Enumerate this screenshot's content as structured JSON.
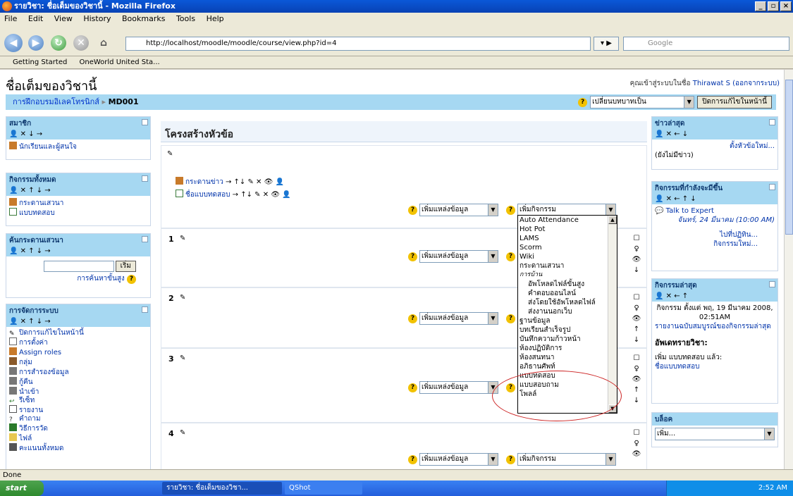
{
  "window": {
    "title": "รายวิชา: ชื่อเต็มของวิชานี้ - Mozilla Firefox",
    "buttons": [
      "_",
      "▫",
      "×"
    ]
  },
  "menu": [
    "File",
    "Edit",
    "View",
    "History",
    "Bookmarks",
    "Tools",
    "Help"
  ],
  "toolbar": {
    "url": "http://localhost/moodle/moodle/course/view.php?id=4",
    "search_placeholder": "Google"
  },
  "bookmarks": [
    "Getting Started",
    "OneWorld United Sta..."
  ],
  "page": {
    "course_title": "ชื่อเต็มของวิชานี้",
    "logged_in_text": "คุณเข้าสู่ระบบในชื่อ",
    "user_name": "Thirawat S",
    "logout_text": "(ออกจากระบบ)",
    "breadcrumb_link": "การฝึกอบรมอิเลคโทรนิกส์",
    "breadcrumb_current": "MD001",
    "switch_role": "เปลี่ยนบทบาทเป็น",
    "turn_editing_off": "ปิดการแก้ไขในหน้านี้"
  },
  "left_blocks": {
    "members": {
      "title": "สมาชิก",
      "item": "นักเรียนและผู้สนใจ"
    },
    "activities": {
      "title": "กิจกรรมทั้งหมด",
      "items": [
        "กระดานเสวนา",
        "แบบทดสอบ"
      ]
    },
    "search": {
      "title": "ค้นกระดานเสวนา",
      "button": "เริ่ม",
      "advanced": "การค้นหาขั้นสูง"
    },
    "admin": {
      "title": "การจัดการระบบ",
      "items": [
        "ปิดการแก้ไขในหน้านี้",
        "การตั้งค่า",
        "Assign roles",
        "กลุ่ม",
        "การสำรองข้อมูล",
        "กู้คืน",
        "นำเข้า",
        "รีเซ็ท",
        "รายงาน",
        "คำถาม",
        "วิธีการวัด",
        "ไฟล์",
        "คะแนนทั้งหมด"
      ]
    }
  },
  "topics": {
    "title": "โครงสร้างหัวข้อ",
    "section0_items": [
      "กระดานข่าว",
      "ชื่อแบบทดสอบ"
    ],
    "sections": [
      "1",
      "2",
      "3",
      "4"
    ],
    "add_resource": "เพิ่มแหล่งข้อมูล",
    "add_activity": "เพิ่มกิจกรรม"
  },
  "dropdown_options": [
    "Auto Attendance",
    "Hot Pot",
    "LAMS",
    "Scorm",
    "Wiki",
    "กระดานเสวนา",
    "การบ้าน",
    "อัพโหลดไฟล์ขั้นสูง",
    "คำตอบออนไลน์",
    "ส่งโดยใช้อัพโหลดไฟล์",
    "ส่งงานนอกเว็บ",
    "ฐานข้อมูล",
    "บทเรียนสำเร็จรูป",
    "บันทึกความก้าวหน้า",
    "ห้องปฏิบัติการ",
    "ห้องสนทนา",
    "อภิธานศัพท์",
    "แบบทดสอบ",
    "แบบสอบถาม",
    "โพลล์"
  ],
  "right_blocks": {
    "news": {
      "title": "ข่าวล่าสุด",
      "add": "ตั้งหัวข้อใหม่...",
      "empty": "(ยังไม่มีข่าว)"
    },
    "upcoming": {
      "title": "กิจกรรมที่กำลังจะมีขึ้น",
      "event": "Talk to Expert",
      "date": "จันทร์, 24 มีนาคม (10:00 AM)",
      "goto": "ไปที่ปฏิทิน...",
      "new": "กิจกรรมใหม่..."
    },
    "recent": {
      "title": "กิจกรรมล่าสุด",
      "since": "กิจกรรม ตั้งแต่ พฤ, 19 มีนาคม 2008, 02:51AM",
      "full": "รายงานฉบับสมบูรณ์ของกิจกรรมล่าสุด",
      "updates": "อัพเดทรายวิชา:",
      "added": "เพิ่ม แบบทดสอบ แล้ว:",
      "quiz": "ชื่อแบบทดสอบ"
    },
    "blocks": {
      "title": "บล็อค",
      "add": "เพิ่ม..."
    }
  },
  "status": "Done",
  "taskbar": {
    "start": "start",
    "items": [
      "รายวิชา: ชื่อเต็มของวิชา...",
      "QShot"
    ],
    "clock": "2:52 AM"
  }
}
